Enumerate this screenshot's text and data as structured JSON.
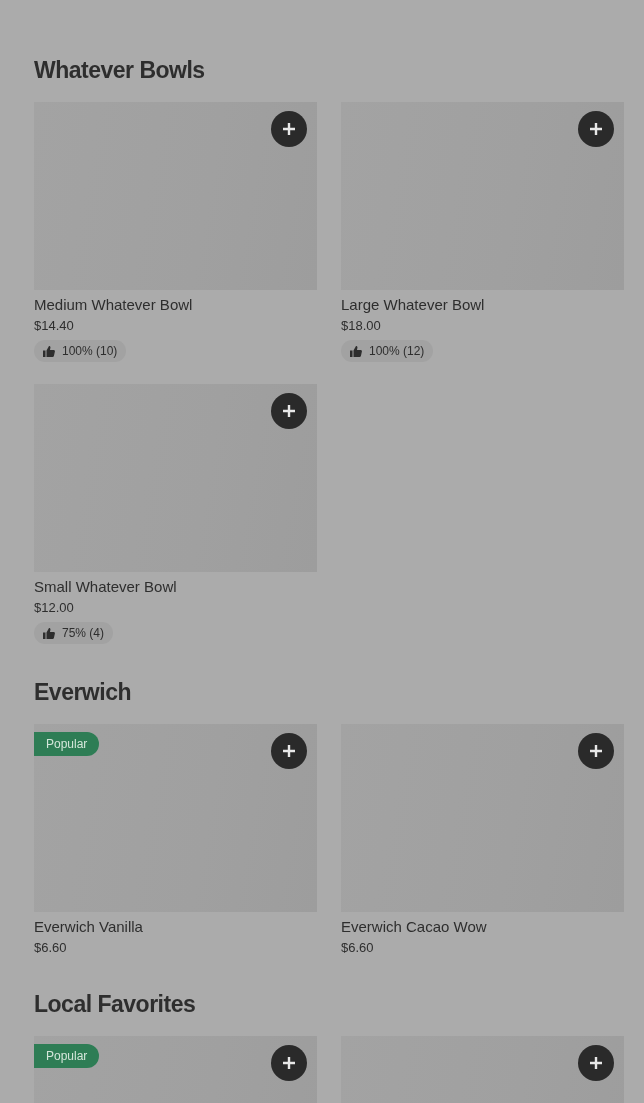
{
  "sections": [
    {
      "title": "Whatever Bowls",
      "items": [
        {
          "kind": "product",
          "name": "Medium Whatever Bowl",
          "price": "$14.40",
          "rating": "100% (10)"
        },
        {
          "kind": "product",
          "name": "Large Whatever Bowl",
          "price": "$18.00",
          "rating": "100% (12)"
        },
        {
          "kind": "product",
          "name": "Small Whatever Bowl",
          "price": "$12.00",
          "rating": "75% (4)"
        }
      ]
    },
    {
      "title": "Everwich",
      "items": [
        {
          "kind": "product",
          "name": "Everwich Vanilla",
          "price": "$6.60",
          "badge": "Popular"
        },
        {
          "kind": "product",
          "name": "Everwich Cacao Wow",
          "price": "$6.60"
        }
      ]
    },
    {
      "title": "Local Favorites",
      "items": [
        {
          "kind": "product",
          "badge": "Popular"
        },
        {
          "kind": "product"
        }
      ]
    }
  ]
}
